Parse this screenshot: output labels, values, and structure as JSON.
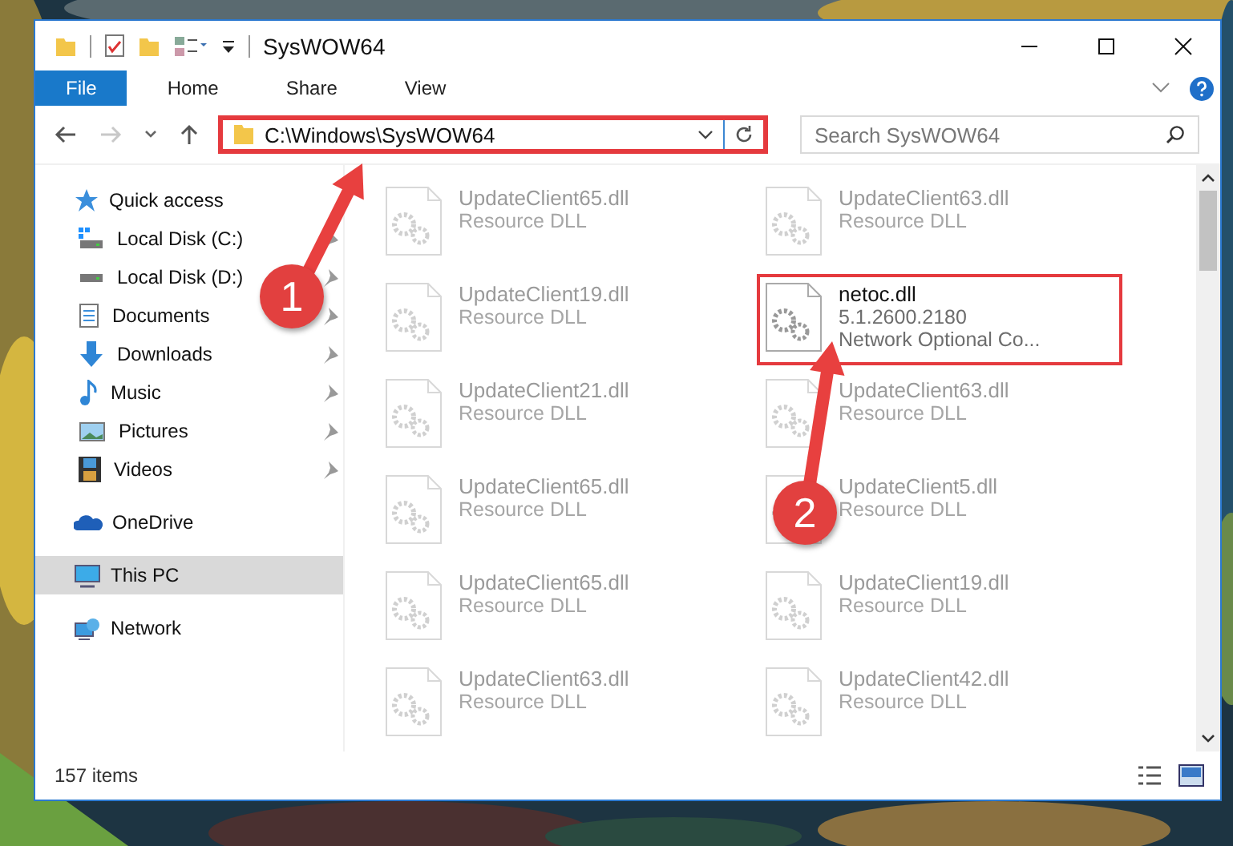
{
  "window": {
    "title": "SysWOW64"
  },
  "ribbon_tabs": [
    {
      "label": "File",
      "selected": true
    },
    {
      "label": "Home",
      "selected": false
    },
    {
      "label": "Share",
      "selected": false
    },
    {
      "label": "View",
      "selected": false
    }
  ],
  "nav_buttons": [
    {
      "kind": "back",
      "disabled": false
    },
    {
      "kind": "forward",
      "disabled": true
    }
  ],
  "address": {
    "path": "C:\\Windows\\SysWOW64",
    "highlighted": true
  },
  "search": {
    "placeholder": "Search SysWOW64"
  },
  "sidebar": {
    "items": [
      {
        "label": "Quick access",
        "kind": "star",
        "selected": false,
        "children": [
          {
            "label": "Local Disk (C:)",
            "kind": "system-drive",
            "pinned": true,
            "selected": false
          },
          {
            "label": "Local Disk (D:)",
            "kind": "drive",
            "pinned": true,
            "selected": false
          },
          {
            "label": "Documents",
            "kind": "documents",
            "pinned": true,
            "selected": false
          },
          {
            "label": "Downloads",
            "kind": "downloads",
            "pinned": true,
            "selected": false
          },
          {
            "label": "Music",
            "kind": "music",
            "pinned": true,
            "selected": false
          },
          {
            "label": "Pictures",
            "kind": "pictures",
            "pinned": true,
            "selected": false
          },
          {
            "label": "Videos",
            "kind": "videos",
            "pinned": true,
            "selected": false
          }
        ]
      },
      {
        "label": "OneDrive",
        "kind": "cloud",
        "selected": false
      },
      {
        "label": "This PC",
        "kind": "computer",
        "selected": true
      },
      {
        "label": "Network",
        "kind": "network",
        "selected": false
      }
    ]
  },
  "files": [
    {
      "name": "UpdateClient65.dll",
      "details": [
        "Resource DLL"
      ],
      "highlighted": false
    },
    {
      "name": "UpdateClient63.dll",
      "details": [
        "Resource DLL"
      ],
      "highlighted": false
    },
    {
      "name": "UpdateClient19.dll",
      "details": [
        "Resource DLL"
      ],
      "highlighted": false
    },
    {
      "name": "netoc.dll",
      "details": [
        "5.1.2600.2180",
        "Network Optional Co..."
      ],
      "highlighted": true
    },
    {
      "name": "UpdateClient21.dll",
      "details": [
        "Resource DLL"
      ],
      "highlighted": false
    },
    {
      "name": "UpdateClient63.dll",
      "details": [
        "Resource DLL"
      ],
      "highlighted": false
    },
    {
      "name": "UpdateClient65.dll",
      "details": [
        "Resource DLL"
      ],
      "highlighted": false
    },
    {
      "name": "UpdateClient5.dll",
      "details": [
        "Resource DLL"
      ],
      "highlighted": false
    },
    {
      "name": "UpdateClient65.dll",
      "details": [
        "Resource DLL"
      ],
      "highlighted": false
    },
    {
      "name": "UpdateClient19.dll",
      "details": [
        "Resource DLL"
      ],
      "highlighted": false
    },
    {
      "name": "UpdateClient63.dll",
      "details": [
        "Resource DLL"
      ],
      "highlighted": false
    },
    {
      "name": "UpdateClient42.dll",
      "details": [
        "Resource DLL"
      ],
      "highlighted": false
    }
  ],
  "status_bar": {
    "item_count": "157 items"
  },
  "callouts": [
    {
      "number": "1"
    },
    {
      "number": "2"
    }
  ]
}
